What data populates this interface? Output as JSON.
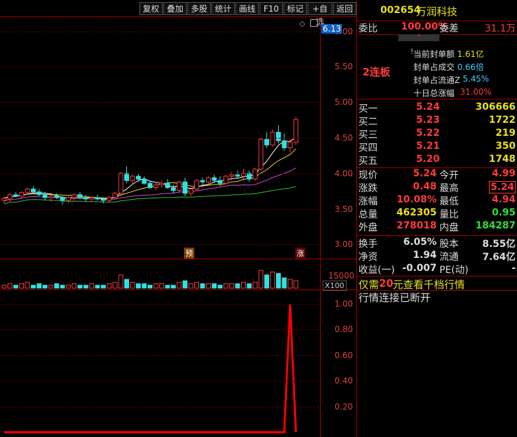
{
  "toolbar": {
    "buttons": [
      "复权",
      "叠加",
      "多股",
      "统计",
      "画线",
      "F10",
      "标记",
      "+自选",
      "返回"
    ]
  },
  "stock": {
    "code": "002654",
    "name": "万润科技"
  },
  "order_ratio": {
    "label_ratio": "委比",
    "ratio": "100.00%",
    "label_diff": "委差",
    "diff": "31.1万"
  },
  "limit_info": {
    "streak": "2连板",
    "rows": [
      {
        "label": "当前封单额",
        "value": "1.61亿"
      },
      {
        "label": "封单占成交",
        "value": "0.66倍"
      },
      {
        "label": "封单占流通Z",
        "value": "5.45%"
      },
      {
        "label": "十日总涨幅",
        "value": "31.00%"
      }
    ]
  },
  "bids": [
    {
      "label": "买一",
      "price": "5.24",
      "vol": "306666"
    },
    {
      "label": "买二",
      "price": "5.23",
      "vol": "1722"
    },
    {
      "label": "买三",
      "price": "5.22",
      "vol": "219"
    },
    {
      "label": "买四",
      "price": "5.21",
      "vol": "350"
    },
    {
      "label": "买五",
      "price": "5.20",
      "vol": "1748"
    }
  ],
  "quote": [
    {
      "l1": "现价",
      "v1": "5.24",
      "l2": "今开",
      "v2": "4.99"
    },
    {
      "l1": "涨跌",
      "v1": "0.48",
      "l2": "最高",
      "v2": "5.24"
    },
    {
      "l1": "涨幅",
      "v1": "10.08%",
      "l2": "最低",
      "v2": "4.94"
    },
    {
      "l1": "总量",
      "v1": "462305",
      "l2": "量比",
      "v2": "0.95"
    },
    {
      "l1": "外盘",
      "v1": "278018",
      "l2": "内盘",
      "v2": "184287"
    },
    {
      "l1": "换手",
      "v1": "6.05%",
      "l2": "股本",
      "v2": "8.55亿"
    },
    {
      "l1": "净资",
      "v1": "1.94",
      "l2": "流通",
      "v2": "7.64亿"
    },
    {
      "l1": "收益(一)",
      "v1": "-0.007",
      "l2": "PE(动)",
      "v2": "-"
    }
  ],
  "promo": {
    "pre": "仅需",
    "num": "20",
    "post": "元查看千档行情"
  },
  "status": "行情连接已断开",
  "price_axis": {
    "current": "6.13",
    "ticks": [
      "6.00",
      "5.50",
      "5.00",
      "4.50",
      "4.00",
      "3.50",
      "3.00"
    ]
  },
  "vol_axis": {
    "tick": "15000",
    "unit": "X100"
  },
  "ind_axis": {
    "ticks": [
      "1.00",
      "0.80",
      "0.60",
      "0.40",
      "0.20"
    ]
  },
  "markers": {
    "a": "预",
    "b": "涨"
  },
  "colors": {
    "up": "#ff3b3b",
    "down": "#30e0e0",
    "ma5": "#ffffff",
    "ma10": "#e8e020",
    "ma20": "#e040e0",
    "ma60": "#30c030",
    "signal": "#ff0000"
  },
  "chart_data": {
    "type": "candlestick",
    "candles": [
      [
        3.62,
        3.68,
        3.58,
        3.65
      ],
      [
        3.64,
        3.72,
        3.6,
        3.7
      ],
      [
        3.7,
        3.74,
        3.66,
        3.68
      ],
      [
        3.68,
        3.75,
        3.65,
        3.73
      ],
      [
        3.73,
        3.8,
        3.7,
        3.78
      ],
      [
        3.78,
        3.82,
        3.72,
        3.74
      ],
      [
        3.74,
        3.78,
        3.68,
        3.7
      ],
      [
        3.7,
        3.74,
        3.62,
        3.66
      ],
      [
        3.66,
        3.7,
        3.6,
        3.68
      ],
      [
        3.68,
        3.72,
        3.64,
        3.66
      ],
      [
        3.66,
        3.68,
        3.56,
        3.62
      ],
      [
        3.62,
        3.68,
        3.58,
        3.66
      ],
      [
        3.66,
        3.72,
        3.62,
        3.7
      ],
      [
        3.7,
        3.74,
        3.64,
        3.66
      ],
      [
        3.66,
        3.7,
        3.6,
        3.64
      ],
      [
        3.64,
        3.68,
        3.6,
        3.66
      ],
      [
        3.66,
        3.7,
        3.62,
        3.64
      ],
      [
        3.64,
        3.66,
        3.58,
        3.62
      ],
      [
        3.62,
        3.68,
        3.6,
        3.66
      ],
      [
        3.66,
        3.74,
        3.64,
        3.72
      ],
      [
        3.72,
        4.02,
        3.7,
        4.0
      ],
      [
        4.0,
        4.1,
        3.86,
        3.9
      ],
      [
        3.9,
        3.98,
        3.84,
        3.96
      ],
      [
        3.96,
        4.0,
        3.88,
        3.92
      ],
      [
        3.92,
        3.96,
        3.84,
        3.86
      ],
      [
        3.86,
        3.9,
        3.78,
        3.8
      ],
      [
        3.8,
        3.88,
        3.76,
        3.84
      ],
      [
        3.84,
        3.9,
        3.8,
        3.86
      ],
      [
        3.86,
        3.92,
        3.78,
        3.8
      ],
      [
        3.8,
        3.84,
        3.72,
        3.76
      ],
      [
        3.76,
        3.9,
        3.74,
        3.88
      ],
      [
        3.88,
        3.94,
        3.68,
        3.72
      ],
      [
        3.72,
        3.8,
        3.68,
        3.78
      ],
      [
        3.78,
        3.92,
        3.76,
        3.9
      ],
      [
        3.9,
        3.94,
        3.84,
        3.88
      ],
      [
        3.88,
        3.96,
        3.82,
        3.94
      ],
      [
        3.94,
        3.98,
        3.86,
        3.9
      ],
      [
        3.9,
        3.96,
        3.82,
        3.86
      ],
      [
        3.86,
        3.98,
        3.84,
        3.96
      ],
      [
        3.96,
        4.02,
        3.9,
        3.98
      ],
      [
        3.98,
        4.04,
        3.92,
        3.96
      ],
      [
        3.96,
        4.06,
        3.92,
        4.0
      ],
      [
        4.0,
        4.04,
        3.88,
        3.92
      ],
      [
        3.92,
        4.08,
        3.9,
        4.06
      ],
      [
        4.06,
        4.5,
        4.04,
        4.48
      ],
      [
        4.48,
        4.58,
        4.36,
        4.4
      ],
      [
        4.4,
        4.62,
        4.38,
        4.58
      ],
      [
        4.58,
        4.68,
        4.42,
        4.46
      ],
      [
        4.46,
        4.56,
        4.32,
        4.36
      ],
      [
        4.36,
        4.48,
        4.3,
        4.44
      ],
      [
        4.44,
        4.8,
        4.4,
        4.76
      ]
    ],
    "volumes": [
      2,
      3,
      2,
      3,
      4,
      2,
      3,
      2,
      2,
      3,
      2,
      2,
      3,
      2,
      2,
      3,
      2,
      2,
      3,
      4,
      9,
      6,
      4,
      3,
      3,
      2,
      3,
      3,
      2,
      2,
      4,
      5,
      3,
      4,
      3,
      3,
      3,
      2,
      3,
      3,
      3,
      4,
      3,
      4,
      12,
      9,
      11,
      10,
      7,
      6,
      5
    ],
    "signal": [
      0,
      0,
      0,
      0,
      0,
      0,
      0,
      0,
      0,
      0,
      0,
      0,
      0,
      0,
      0,
      0,
      0,
      0,
      0,
      0,
      0,
      0,
      0,
      0,
      0,
      0,
      0,
      0,
      0,
      0,
      0,
      0,
      0,
      0,
      0,
      0,
      0,
      0,
      0,
      0,
      0,
      0,
      0,
      0,
      0,
      0,
      0,
      0,
      0,
      1,
      0,
      0,
      0,
      0,
      0,
      0
    ],
    "ylim": [
      2.8,
      6.2
    ]
  }
}
